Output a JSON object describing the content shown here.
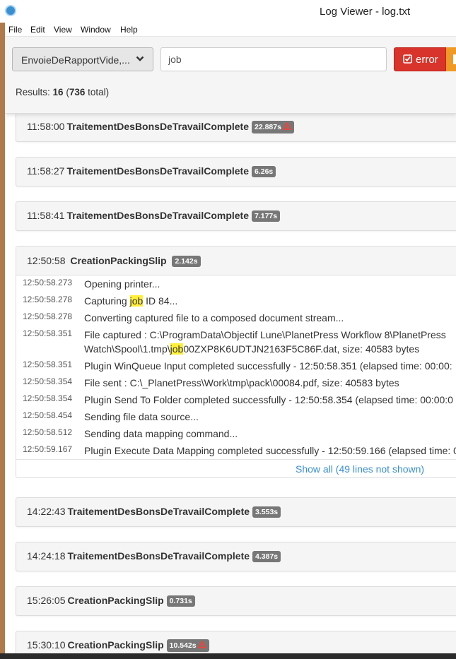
{
  "window": {
    "title": "Log Viewer - log.txt"
  },
  "menu": [
    "File",
    "Edit",
    "View",
    "Window",
    "Help"
  ],
  "toolbar": {
    "dropdown_value": "EnvoieDeRapportVide,...",
    "search_value": "job",
    "error_button": "error"
  },
  "results": {
    "prefix": "Results: ",
    "count": "16",
    "open": " (",
    "total": "736",
    "suffix": " total)"
  },
  "entries": [
    {
      "time": "11:58:00",
      "name": "TraitementDesBonsDeTravailComplete",
      "duration": "22.887s",
      "warning": true
    },
    {
      "time": "11:58:27",
      "name": "TraitementDesBonsDeTravailComplete",
      "duration": "6.26s",
      "warning": false
    },
    {
      "time": "11:58:41",
      "name": "TraitementDesBonsDeTravailComplete",
      "duration": "7.177s",
      "warning": false
    },
    {
      "time": "14:22:43",
      "name": "TraitementDesBonsDeTravailComplete",
      "duration": "3.553s",
      "warning": false
    },
    {
      "time": "14:24:18",
      "name": "TraitementDesBonsDeTravailComplete",
      "duration": "4.387s",
      "warning": false
    },
    {
      "time": "15:26:05",
      "name": "CreationPackingSlip",
      "duration": "0.731s",
      "warning": false
    },
    {
      "time": "15:30:10",
      "name": "CreationPackingSlip",
      "duration": "10.542s",
      "warning": true
    }
  ],
  "expanded": {
    "time": "12:50:58",
    "name": "CreationPackingSlip",
    "duration": "2.142s",
    "lines": [
      {
        "t": "12:50:58.273",
        "pre": "Opening printer...",
        "hl": "",
        "post": ""
      },
      {
        "t": "12:50:58.278",
        "pre": "Capturing ",
        "hl": "job",
        "post": " ID 84..."
      },
      {
        "t": "12:50:58.278",
        "pre": "Converting captured file to a composed document stream...",
        "hl": "",
        "post": ""
      },
      {
        "t": "12:50:58.351",
        "pre": "File captured : C:\\ProgramData\\Objectif Lune\\PlanetPress Workflow 8\\PlanetPress",
        "pre2": "Watch\\Spool\\1.tmp\\",
        "hl": "job",
        "post": "00ZXP8K6UDTJN2163F5C86F.dat, size: 40583 bytes"
      },
      {
        "t": "12:50:58.351",
        "pre": "Plugin WinQueue Input completed successfully - 12:50:58.351 (elapsed time: 00:00:",
        "hl": "",
        "post": ""
      },
      {
        "t": "12:50:58.354",
        "pre": "File sent : C:\\_PlanetPress\\Work\\tmp\\pack\\00084.pdf, size: 40583 bytes",
        "hl": "",
        "post": ""
      },
      {
        "t": "12:50:58.354",
        "pre": "Plugin Send To Folder completed successfully - 12:50:58.354 (elapsed time: 00:00:0",
        "hl": "",
        "post": ""
      },
      {
        "t": "12:50:58.454",
        "pre": "Sending file data source...",
        "hl": "",
        "post": ""
      },
      {
        "t": "12:50:58.512",
        "pre": "Sending data mapping command...",
        "hl": "",
        "post": ""
      },
      {
        "t": "12:50:59.167",
        "pre": "Plugin Execute Data Mapping completed successfully - 12:50:59.166 (elapsed time: 0",
        "hl": "",
        "post": ""
      }
    ],
    "show_all": "Show all (49 lines not shown)"
  },
  "colors": {
    "error": "#d9342b",
    "warning": "#ef9a26",
    "badge": "#777777",
    "highlight": "#ffef3a",
    "link": "#3a8fd8"
  }
}
